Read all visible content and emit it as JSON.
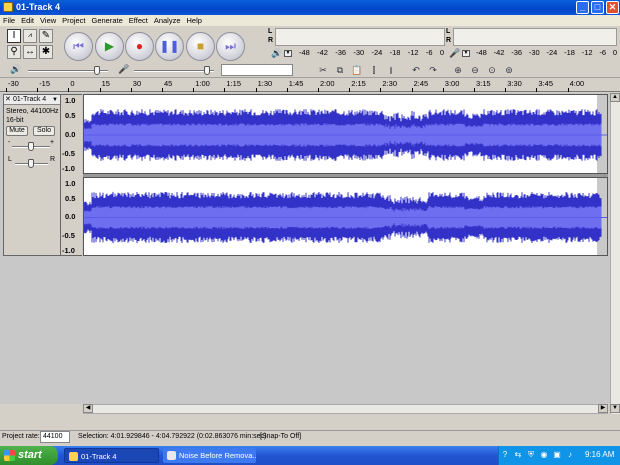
{
  "window": {
    "title": "01-Track 4"
  },
  "menu": [
    "File",
    "Edit",
    "View",
    "Project",
    "Generate",
    "Effect",
    "Analyze",
    "Help"
  ],
  "meters": {
    "left_label": "L",
    "right_label": "R",
    "scale": [
      "-48",
      "-42",
      "-36",
      "-30",
      "-24",
      "-18",
      "-12",
      "-6",
      "0"
    ]
  },
  "ruler": [
    "-30",
    "-15",
    "0",
    "15",
    "30",
    "45",
    "1:00",
    "1:15",
    "1:30",
    "1:45",
    "2:00",
    "2:15",
    "2:30",
    "2:45",
    "3:00",
    "3:15",
    "3:30",
    "3:45",
    "4:00"
  ],
  "track": {
    "name": "01-Track 4",
    "info1": "Stereo, 44100Hz",
    "info2": "16-bit",
    "mute": "Mute",
    "solo": "Solo",
    "minus": "-",
    "plus": "+",
    "pan_left": "L",
    "pan_right": "R",
    "close": "✕",
    "dropdown": "▼",
    "scale": [
      "1.0",
      "0.5",
      "0.0",
      "-0.5",
      "-1.0"
    ],
    "waveform_color": "#3232c8"
  },
  "status": {
    "project_rate_label": "Project rate:",
    "project_rate": "44100",
    "selection": "Selection: 4:01.929846 - 4:04.792922 (0:02.863076 min:sec)",
    "snap": "[Snap-To Off]"
  },
  "taskbar": {
    "start": "start",
    "tasks": [
      "01-Track 4",
      "Noise Before Remova..."
    ],
    "clock": "9:16 AM"
  }
}
